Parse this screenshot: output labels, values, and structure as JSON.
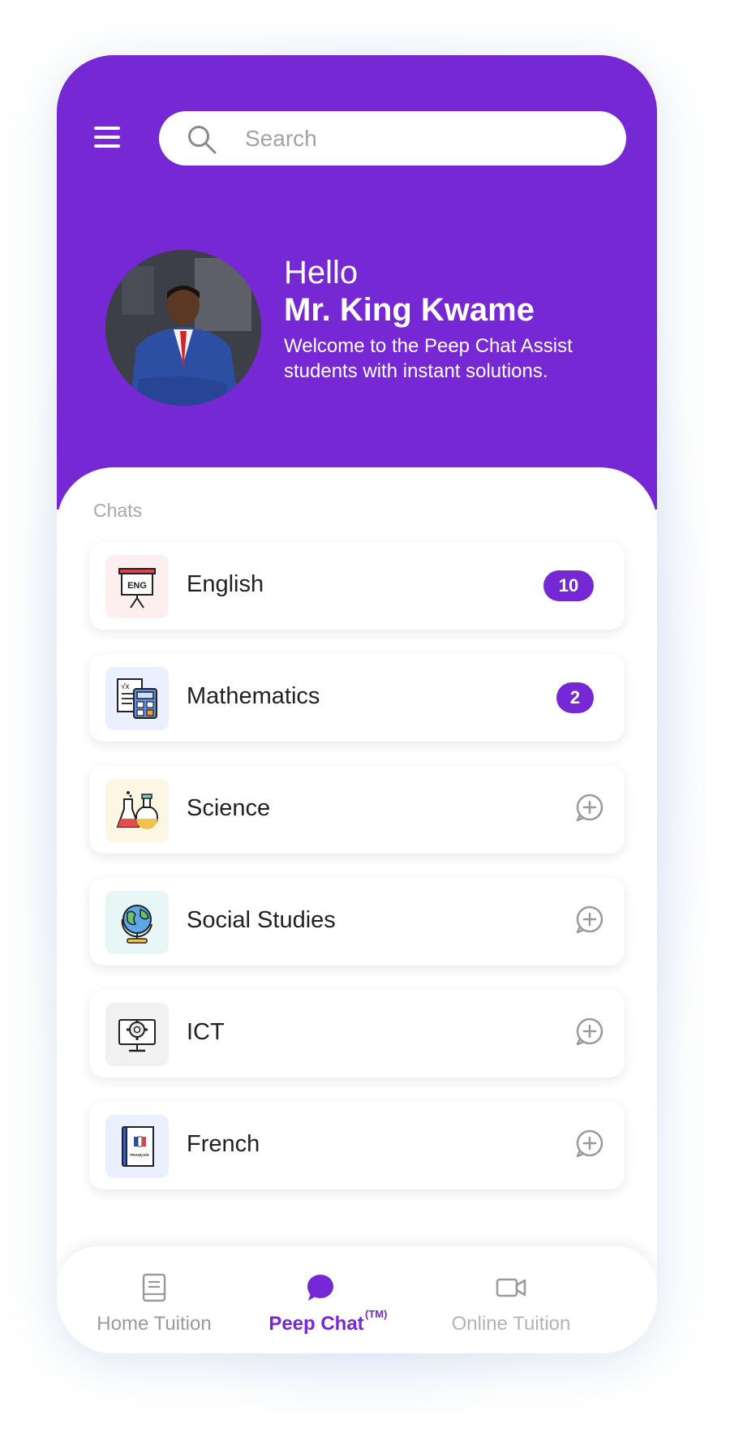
{
  "search": {
    "placeholder": "Search"
  },
  "greeting": {
    "hello": "Hello",
    "name": "Mr. King Kwame",
    "welcome": "Welcome to the Peep Chat Assist students with instant solutions."
  },
  "chats": {
    "label": "Chats",
    "items": [
      {
        "label": "English",
        "badge": "10",
        "icon": "presentation-board-icon",
        "icon_text": "ENG"
      },
      {
        "label": "Mathematics",
        "badge": "2",
        "icon": "calculator-icon"
      },
      {
        "label": "Science",
        "badge": "",
        "icon": "flasks-icon"
      },
      {
        "label": "Social Studies",
        "badge": "",
        "icon": "globe-icon"
      },
      {
        "label": "ICT",
        "badge": "",
        "icon": "computer-gear-icon"
      },
      {
        "label": "French",
        "badge": "",
        "icon": "french-book-icon",
        "icon_text": "FRANÇAIS"
      }
    ]
  },
  "bottom_nav": {
    "items": [
      {
        "label": "Home Tuition",
        "icon": "book-icon",
        "active": false
      },
      {
        "label": "Peep Chat",
        "superscript": "(TM)",
        "icon": "chat-bubble-icon",
        "active": true
      },
      {
        "label": "Online Tuition",
        "icon": "video-camera-icon",
        "active": false
      }
    ]
  },
  "colors": {
    "primary": "#7528d3",
    "inactive": "#9a9a9a",
    "text": "#222222"
  }
}
